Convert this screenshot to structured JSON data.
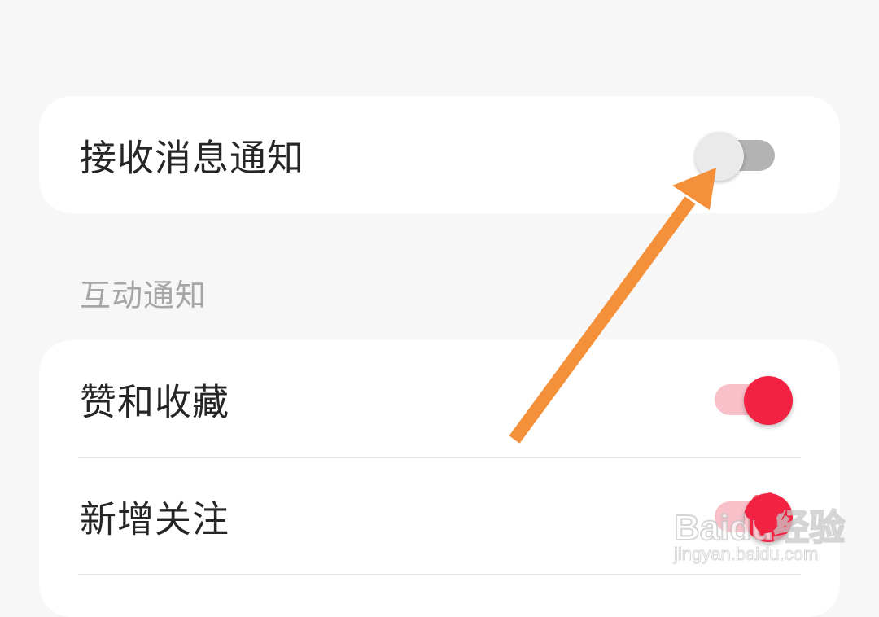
{
  "master_setting": {
    "label": "接收消息通知",
    "enabled": false
  },
  "interaction_section": {
    "title": "互动通知",
    "items": [
      {
        "label": "赞和收藏",
        "enabled": true
      },
      {
        "label": "新增关注",
        "enabled": true
      }
    ]
  },
  "annotation": {
    "type": "arrow",
    "color": "#f5903a",
    "points_to": "master-notification-toggle"
  },
  "watermark": {
    "logo": "Baidu经验",
    "url": "jingyan.baidu.com"
  },
  "colors": {
    "background": "#f7f7f7",
    "card": "#ffffff",
    "accent": "#f22342",
    "toggle_off_track": "#b3b3b3",
    "toggle_off_knob": "#eaeaea",
    "section_title": "#a6a6a6"
  }
}
